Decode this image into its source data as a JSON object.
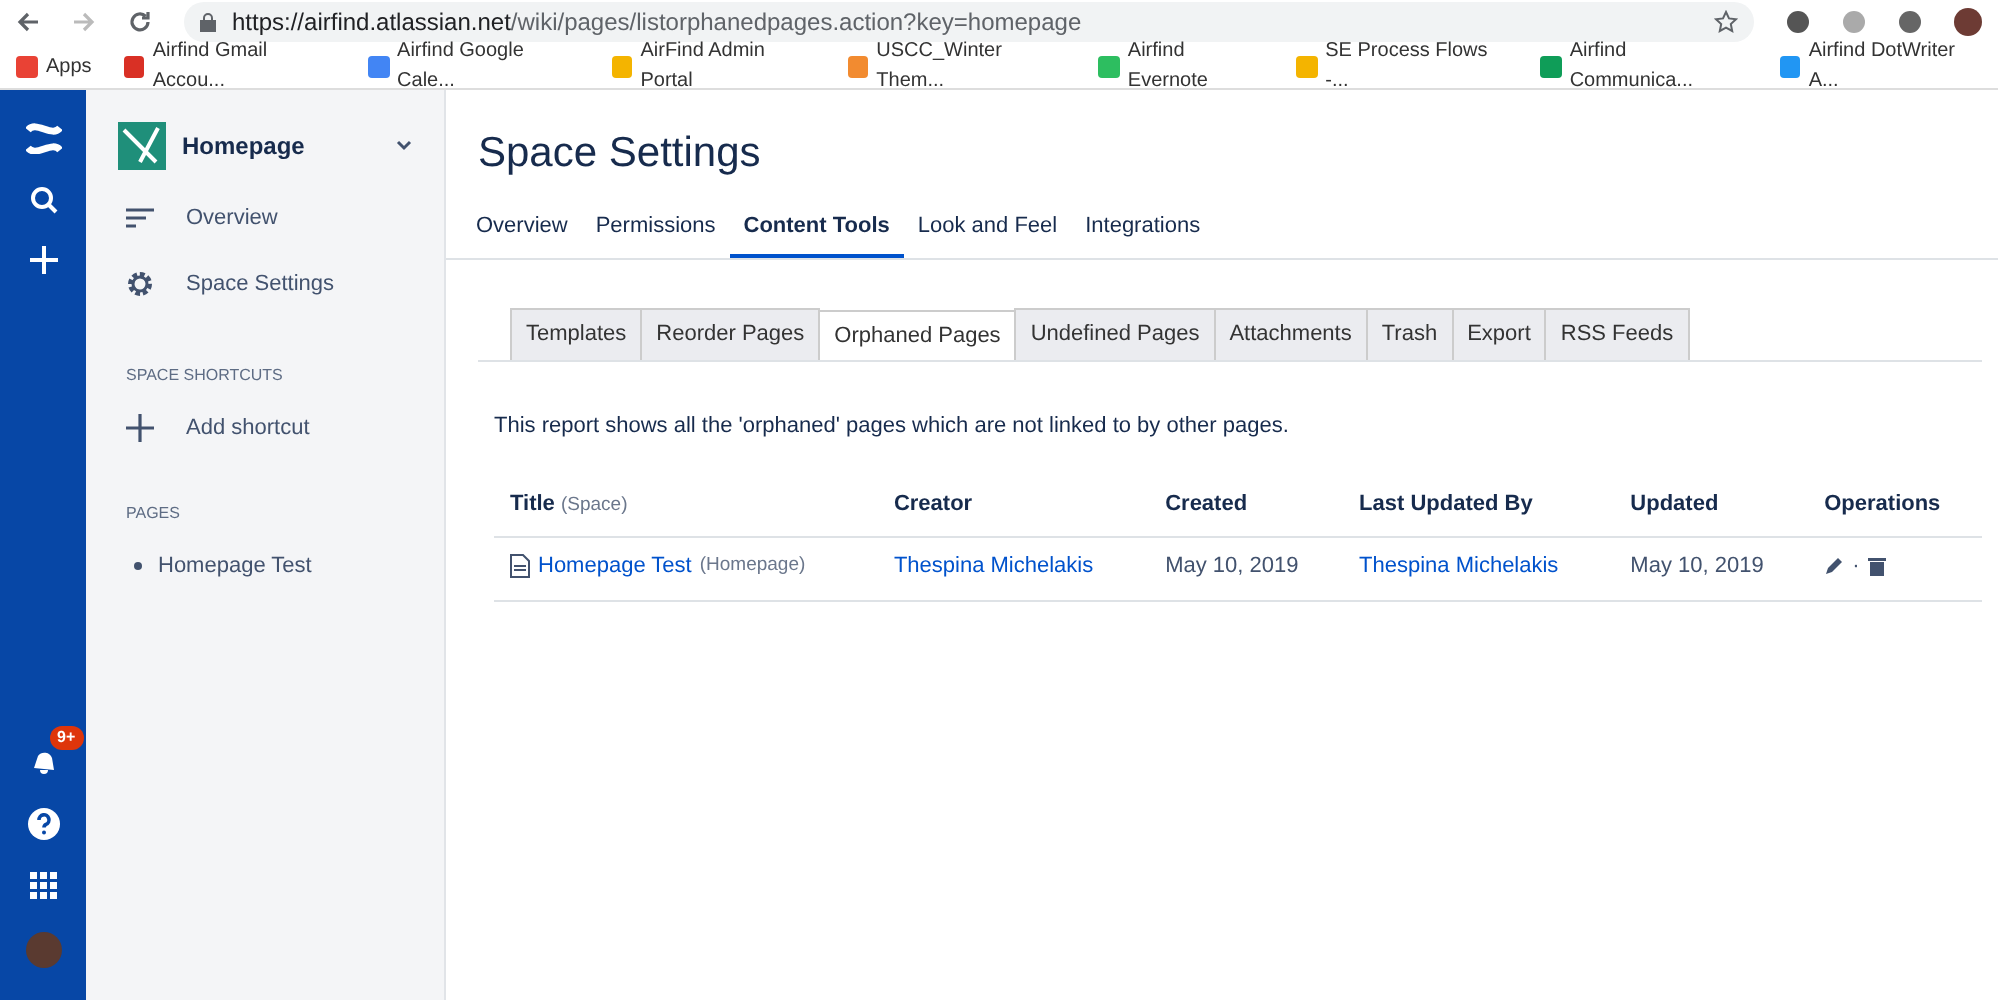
{
  "browser": {
    "url_host": "https://airfind.atlassian.net",
    "url_path": "/wiki/pages/listorphanedpages.action?key=homepage"
  },
  "bookmarks": [
    {
      "label": "Apps",
      "color": "#e94235"
    },
    {
      "label": "Airfind Gmail Accou...",
      "color": "#d93025"
    },
    {
      "label": "Airfind Google Cale...",
      "color": "#4285f4"
    },
    {
      "label": "AirFind Admin Portal",
      "color": "#f4b400"
    },
    {
      "label": "USCC_Winter Them...",
      "color": "#f28b30"
    },
    {
      "label": "Airfind Evernote",
      "color": "#2dbe60"
    },
    {
      "label": "SE Process Flows -...",
      "color": "#f4b400"
    },
    {
      "label": "Airfind Communica...",
      "color": "#0f9d58"
    },
    {
      "label": "Airfind DotWriter A...",
      "color": "#2196f3"
    }
  ],
  "rail": {
    "notification_badge": "9+"
  },
  "sidebar": {
    "space_name": "Homepage",
    "nav": [
      {
        "label": "Overview",
        "kind": "overview"
      },
      {
        "label": "Space Settings",
        "kind": "settings"
      }
    ],
    "shortcuts_heading": "SPACE SHORTCUTS",
    "add_shortcut": "Add shortcut",
    "pages_heading": "PAGES",
    "pages": [
      "Homepage Test"
    ]
  },
  "main": {
    "title": "Space Settings",
    "tabs": [
      {
        "label": "Overview",
        "selected": false
      },
      {
        "label": "Permissions",
        "selected": false
      },
      {
        "label": "Content Tools",
        "selected": true
      },
      {
        "label": "Look and Feel",
        "selected": false
      },
      {
        "label": "Integrations",
        "selected": false
      }
    ],
    "subtabs": [
      {
        "label": "Templates",
        "selected": false
      },
      {
        "label": "Reorder Pages",
        "selected": false
      },
      {
        "label": "Orphaned Pages",
        "selected": true
      },
      {
        "label": "Undefined Pages",
        "selected": false
      },
      {
        "label": "Attachments",
        "selected": false
      },
      {
        "label": "Trash",
        "selected": false
      },
      {
        "label": "Export",
        "selected": false
      },
      {
        "label": "RSS Feeds",
        "selected": false
      }
    ],
    "description": "This report shows all the 'orphaned' pages which are not linked to by other pages.",
    "table": {
      "columns": [
        {
          "label": "Title",
          "note": "(Space)"
        },
        {
          "label": "Creator"
        },
        {
          "label": "Created"
        },
        {
          "label": "Last Updated By"
        },
        {
          "label": "Updated"
        },
        {
          "label": "Operations"
        }
      ],
      "rows": [
        {
          "title": "Homepage Test",
          "space": "(Homepage)",
          "creator": "Thespina Michelakis",
          "created": "May 10, 2019",
          "last_updated_by": "Thespina Michelakis",
          "updated": "May 10, 2019",
          "separator": "·"
        }
      ]
    }
  }
}
